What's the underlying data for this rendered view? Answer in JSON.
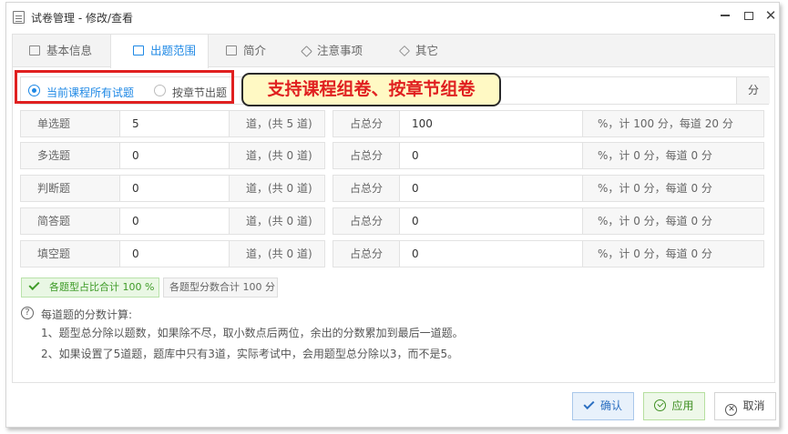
{
  "window": {
    "title": "试卷管理 - 修改/查看",
    "minimize_icon": "minimize-icon",
    "maximize_icon": "maximize-icon",
    "close_glyph": "✕"
  },
  "tabs": [
    {
      "label": "基本信息",
      "icon": "document-icon"
    },
    {
      "label": "出题范围",
      "icon": "edit-document-icon"
    },
    {
      "label": "简介",
      "icon": "card-icon"
    },
    {
      "label": "注意事项",
      "icon": "tag-icon"
    },
    {
      "label": "其它",
      "icon": "layers-icon"
    }
  ],
  "mode": {
    "option_all": "当前课程所有试题",
    "option_chapter": "按章节出题",
    "selected": "当前课程所有试题",
    "unit": "分"
  },
  "callout": {
    "text": "支持课程组卷、按章节组卷",
    "color": "#e02020",
    "background": "#fff9c4"
  },
  "rows": [
    {
      "type": "单选题",
      "count": "5",
      "count_suffix": "道，(共 5 道)",
      "score_label": "占总分",
      "percent": "100",
      "summary": "%，计 100 分，每道 20 分"
    },
    {
      "type": "多选题",
      "count": "0",
      "count_suffix": "道，(共 0 道)",
      "score_label": "占总分",
      "percent": "0",
      "summary": "%，计 0 分，每道 0 分"
    },
    {
      "type": "判断题",
      "count": "0",
      "count_suffix": "道，(共 0 道)",
      "score_label": "占总分",
      "percent": "0",
      "summary": "%，计 0 分，每道 0 分"
    },
    {
      "type": "简答题",
      "count": "0",
      "count_suffix": "道，(共 0 道)",
      "score_label": "占总分",
      "percent": "0",
      "summary": "%，计 0 分，每道 0 分"
    },
    {
      "type": "填空题",
      "count": "0",
      "count_suffix": "道，(共 0 道)",
      "score_label": "占总分",
      "percent": "0",
      "summary": "%，计 0 分，每道 0 分"
    }
  ],
  "badges": {
    "ratio": "各题型占比合计 100 %",
    "score": "各题型分数合计 100 分"
  },
  "help": {
    "icon_glyph": "?",
    "title": "每道题的分数计算:",
    "notes": [
      "1、题型总分除以题数，如果除不尽，取小数点后两位，余出的分数累加到最后一道题。",
      "2、如果设置了5道题，题库中只有3道，实际考试中，会用题型总分除以3，而不是5。"
    ]
  },
  "footer": {
    "ok": "确认",
    "apply": "应用",
    "cancel": "取消",
    "cancel_glyph": "✕"
  },
  "colors": {
    "accent": "#1e88e5",
    "success": "#3e9b27",
    "highlight_border": "#e02020"
  }
}
